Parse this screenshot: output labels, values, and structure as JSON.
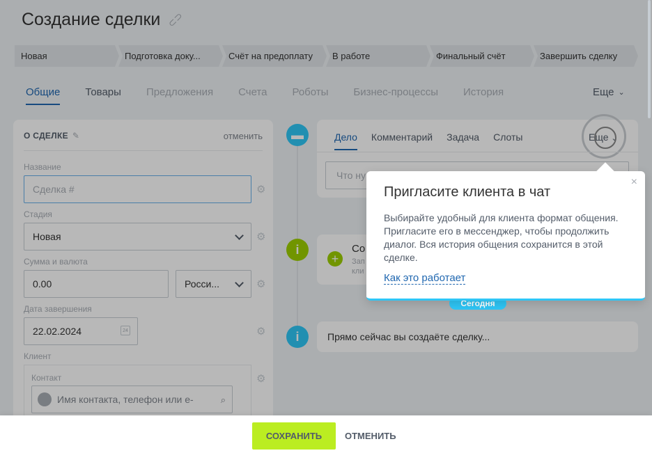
{
  "page": {
    "title": "Создание сделки"
  },
  "stages": [
    "Новая",
    "Подготовка доку...",
    "Счёт на предоплату",
    "В работе",
    "Финальный счёт",
    "Завершить сделку"
  ],
  "tabs": {
    "items": [
      "Общие",
      "Товары",
      "Предложения",
      "Счета",
      "Роботы",
      "Бизнес-процессы",
      "История"
    ],
    "more": "Еще"
  },
  "deal_card": {
    "title": "О СДЕЛКЕ",
    "cancel": "отменить",
    "name_label": "Название",
    "name_placeholder": "Сделка #",
    "stage_label": "Стадия",
    "stage_value": "Новая",
    "amount_label": "Сумма и валюта",
    "amount_value": "0.00",
    "currency_value": "Росси...",
    "date_label": "Дата завершения",
    "date_value": "22.02.2024",
    "calendar_day": "24",
    "client_label": "Клиент",
    "contact_label": "Контакт",
    "contact_placeholder": "Имя контакта, телефон или e-"
  },
  "editor": {
    "tabs": [
      "Дело",
      "Комментарий",
      "Задача",
      "Слоты"
    ],
    "more": "Еще",
    "input_placeholder": "Что ну"
  },
  "timeline": {
    "create_title": "Со",
    "create_sub_1": "Зап",
    "create_sub_2": "кли",
    "today": "Сегодня",
    "info_text": "Прямо сейчас вы создаёте сделку..."
  },
  "popup": {
    "title": "Пригласите клиента в чат",
    "text": "Выбирайте удобный для клиента формат общения. Пригласите его в мессенджер, чтобы продолжить диалог. Вся история общения сохранится в этой сделке.",
    "link": "Как это работает"
  },
  "footer": {
    "save": "СОХРАНИТЬ",
    "cancel": "ОТМЕНИТЬ"
  },
  "colors": {
    "accent_blue": "#2067b0",
    "timeline_blue": "#2fc6f6",
    "green": "#9dcf00",
    "save_green": "#bbed21"
  }
}
